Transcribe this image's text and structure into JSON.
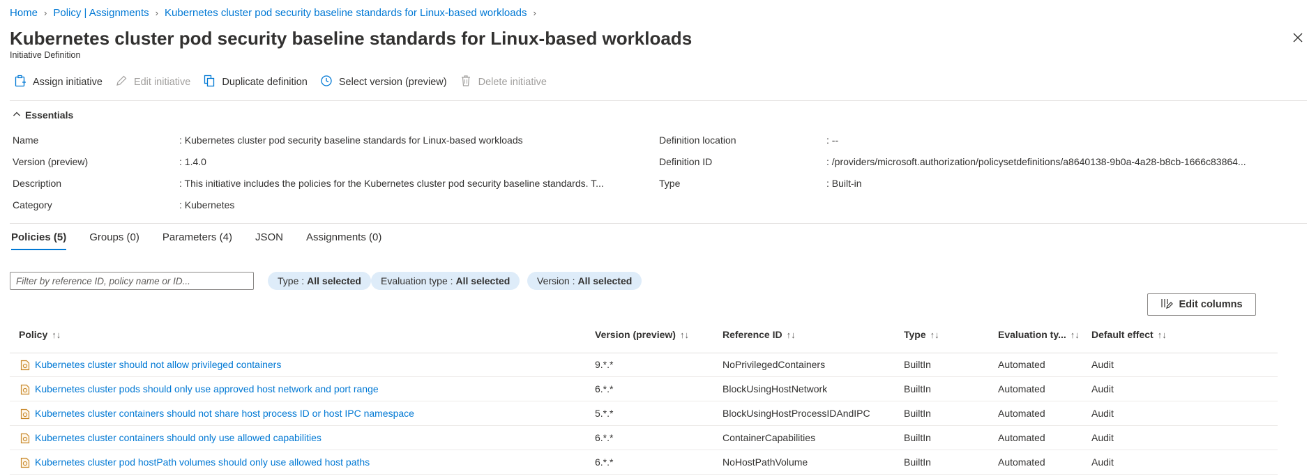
{
  "breadcrumb": {
    "items": [
      "Home",
      "Policy | Assignments",
      "Kubernetes cluster pod security baseline standards for Linux-based workloads"
    ]
  },
  "header": {
    "title": "Kubernetes cluster pod security baseline standards for Linux-based workloads",
    "subtitle": "Initiative Definition",
    "more": "···"
  },
  "toolbar": {
    "assign": "Assign initiative",
    "edit": "Edit initiative",
    "duplicate": "Duplicate definition",
    "select_version": "Select version (preview)",
    "delete": "Delete initiative"
  },
  "essentials": {
    "title": "Essentials",
    "left": [
      {
        "label": "Name",
        "value": ": Kubernetes cluster pod security baseline standards for Linux-based workloads"
      },
      {
        "label": "Version (preview)",
        "value": ": 1.4.0"
      },
      {
        "label": "Description",
        "value": ": This initiative includes the policies for the Kubernetes cluster pod security baseline standards. T..."
      },
      {
        "label": "Category",
        "value": ": Kubernetes"
      }
    ],
    "right": [
      {
        "label": "Definition location",
        "value": ": --"
      },
      {
        "label": "Definition ID",
        "value": ": /providers/microsoft.authorization/policysetdefinitions/a8640138-9b0a-4a28-b8cb-1666c83864..."
      },
      {
        "label": "Type",
        "value": ": Built-in"
      }
    ]
  },
  "tabs": [
    "Policies (5)",
    "Groups (0)",
    "Parameters (4)",
    "JSON",
    "Assignments (0)"
  ],
  "filters": {
    "search_placeholder": "Filter by reference ID, policy name or ID...",
    "pills": [
      {
        "key": "Type :",
        "value": "All selected"
      },
      {
        "key": "Evaluation type :",
        "value": "All selected"
      },
      {
        "key": "Version :",
        "value": "All selected"
      }
    ]
  },
  "edit_columns": "Edit columns",
  "table": {
    "columns": [
      "Policy",
      "Version (preview)",
      "Reference ID",
      "Type",
      "Evaluation ty...",
      "Default effect"
    ],
    "sort_glyph": "↑↓",
    "rows": [
      {
        "policy": "Kubernetes cluster should not allow privileged containers",
        "version": "9.*.*",
        "ref": "NoPrivilegedContainers",
        "type": "BuiltIn",
        "eval": "Automated",
        "effect": "Audit"
      },
      {
        "policy": "Kubernetes cluster pods should only use approved host network and port range",
        "version": "6.*.*",
        "ref": "BlockUsingHostNetwork",
        "type": "BuiltIn",
        "eval": "Automated",
        "effect": "Audit"
      },
      {
        "policy": "Kubernetes cluster containers should not share host process ID or host IPC namespace",
        "version": "5.*.*",
        "ref": "BlockUsingHostProcessIDAndIPC",
        "type": "BuiltIn",
        "eval": "Automated",
        "effect": "Audit"
      },
      {
        "policy": "Kubernetes cluster containers should only use allowed capabilities",
        "version": "6.*.*",
        "ref": "ContainerCapabilities",
        "type": "BuiltIn",
        "eval": "Automated",
        "effect": "Audit"
      },
      {
        "policy": "Kubernetes cluster pod hostPath volumes should only use allowed host paths",
        "version": "6.*.*",
        "ref": "NoHostPathVolume",
        "type": "BuiltIn",
        "eval": "Automated",
        "effect": "Audit"
      }
    ]
  },
  "colors": {
    "accent": "#0078d4",
    "pill_bg": "#deecf9",
    "policy_icon": "#c8882a"
  }
}
